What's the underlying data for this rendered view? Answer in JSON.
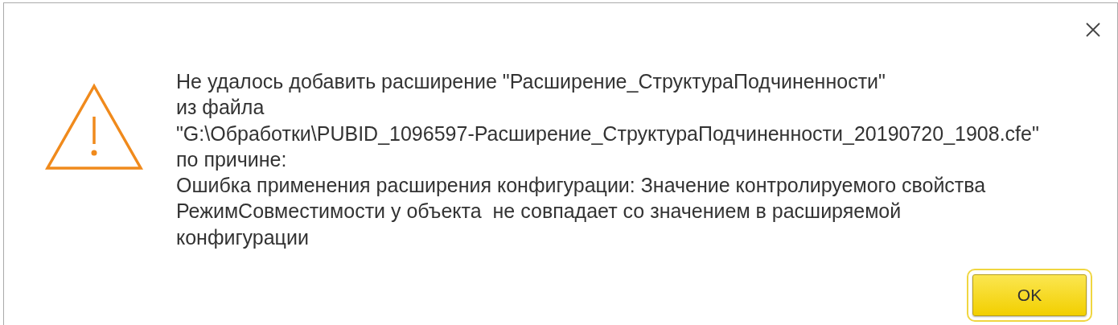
{
  "dialog": {
    "message_lines": [
      "Не удалось добавить расширение \"Расширение_СтруктураПодчиненности\"",
      "из файла",
      "\"G:\\Обработки\\PUBID_1096597-Расширение_СтруктураПодчиненности_20190720_1908.cfe\"",
      "по причине:",
      "Ошибка применения расширения конфигурации: Значение контролируемого свойства",
      "РежимСовместимости у объекта  не совпадает со значением в расширяемой",
      "конфигурации"
    ],
    "buttons": [
      {
        "label": "OK",
        "focused": true
      }
    ]
  }
}
